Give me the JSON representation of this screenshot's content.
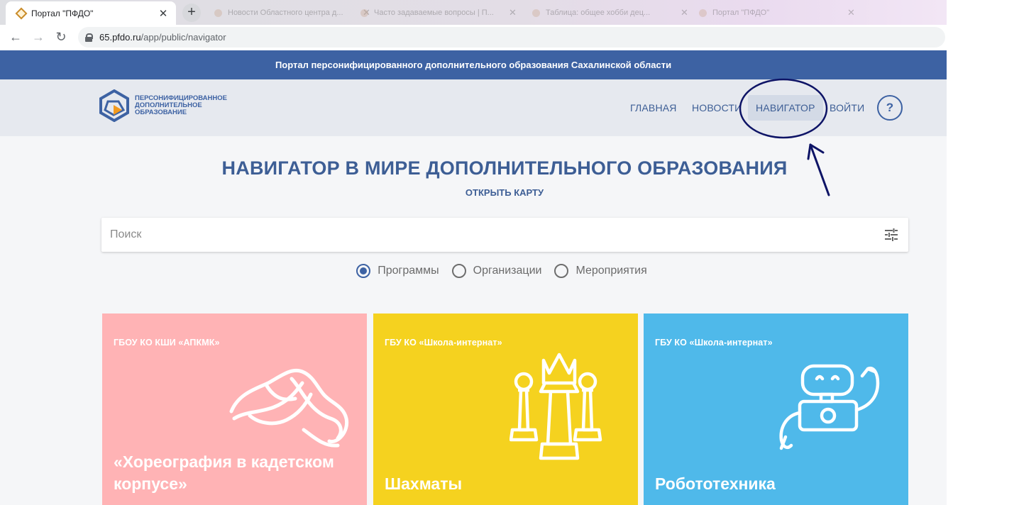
{
  "browser": {
    "active_tab_title": "Портал \"ПФДО\"",
    "background_tab_titles": [
      "Новости Областного центра д...",
      "Часто задаваемые вопросы | П...",
      "Таблица: общее хобби дец...",
      "Портал \"ПФДО\""
    ],
    "url_host": "65.pfdo.ru",
    "url_path": "/app/public/navigator"
  },
  "site": {
    "banner": "Портал персонифицированного дополнительного образования Сахалинской области",
    "logo_lines": [
      "ПЕРСОНИФИЦИРОВАННОЕ",
      "ДОПОЛНИТЕЛЬНОЕ",
      "ОБРАЗОВАНИЕ"
    ],
    "nav": {
      "home": "ГЛАВНАЯ",
      "news": "НОВОСТИ",
      "navigator": "НАВИГАТОР",
      "login": "ВОЙТИ",
      "help": "?"
    },
    "active_nav": "НАВИГАТОР",
    "brand_color": "#3d62a3"
  },
  "main": {
    "title": "НАВИГАТОР В МИРЕ ДОПОЛНИТЕЛЬНОГО ОБРАЗОВАНИЯ",
    "map_link": "ОТКРЫТЬ КАРТУ",
    "search_placeholder": "Поиск",
    "radio_options": [
      "Программы",
      "Организации",
      "Мероприятия"
    ],
    "radio_selected": "Программы",
    "cards": [
      {
        "org": "ГБОУ КО КШИ «АПКМК»",
        "title": "«Хореография в кадетском корпусе»",
        "color": "#ffb3b5",
        "icon": "pointe-shoes-icon"
      },
      {
        "org": "ГБУ КО «Школа-интернат»",
        "title": "Шахматы",
        "color": "#f5d21f",
        "icon": "chess-pieces-icon"
      },
      {
        "org": "ГБУ КО «Школа-интернат»",
        "title": "Робототехника",
        "color": "#4fb9ea",
        "icon": "robot-icon"
      }
    ]
  }
}
